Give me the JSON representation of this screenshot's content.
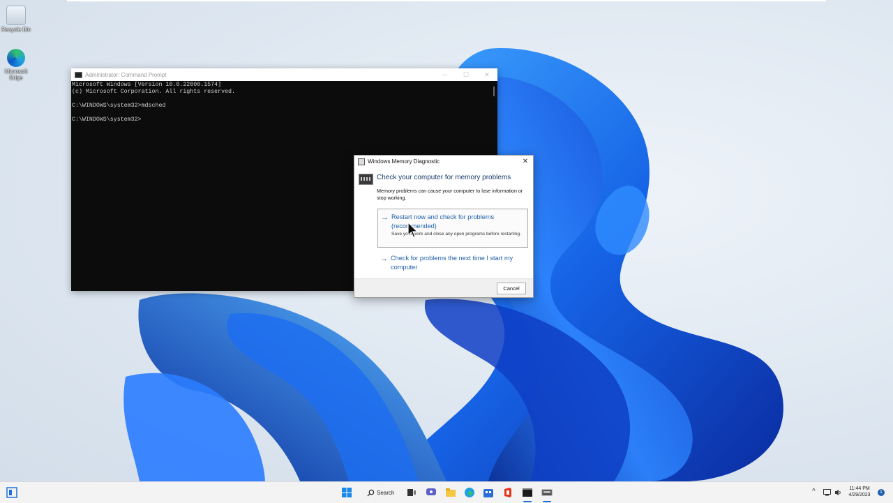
{
  "desktop": {
    "icons": [
      {
        "name": "recycle-bin",
        "label": "Recycle Bin"
      },
      {
        "name": "microsoft-edge",
        "label": "Microsoft Edge"
      }
    ]
  },
  "cmd": {
    "title": "Administrator: Command Prompt",
    "lines": [
      "Microsoft Windows [Version 10.0.22000.1574]",
      "(c) Microsoft Corporation. All rights reserved.",
      "",
      "C:\\WINDOWS\\system32>mdsched",
      "",
      "C:\\WINDOWS\\system32>"
    ],
    "controls": {
      "minimize": "─",
      "maximize": "☐",
      "close": "✕"
    }
  },
  "dialog": {
    "title": "Windows Memory Diagnostic",
    "heading": "Check your computer for memory problems",
    "description": "Memory problems can cause your computer to lose information or stop working.",
    "option1": {
      "title": "Restart now and check for problems (recommended)",
      "subtitle": "Save your work and close any open programs before restarting."
    },
    "option2": {
      "title": "Check for problems the next time I start my computer"
    },
    "cancel": "Cancel",
    "close": "✕",
    "arrow": "→"
  },
  "taskbar": {
    "search_label": "Search",
    "time": "11:44 PM",
    "date": "4/29/2023",
    "notification_count": "1",
    "apps": [
      "start",
      "search",
      "task-view",
      "chat",
      "file-explorer",
      "edge",
      "store",
      "office",
      "terminal",
      "memory-diagnostic"
    ]
  },
  "colors": {
    "accent": "#1f5fa8",
    "bloom_dark": "#0b2a9a",
    "bloom_light": "#3aa0ff"
  }
}
